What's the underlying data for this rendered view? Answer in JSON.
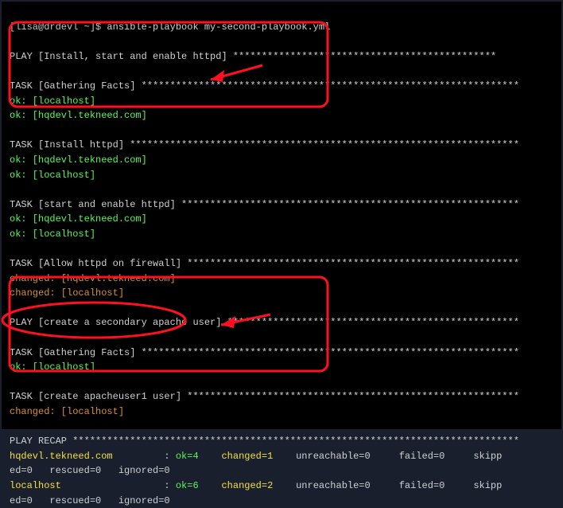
{
  "prompt": {
    "user_host": "[lisa@drdevl ~]$ ",
    "command": "ansible-playbook my-second-playbook.yml"
  },
  "play1": {
    "header": "PLAY [Install, start and enable httpd] **********************************************",
    "task_gather": "TASK [Gathering Facts] ******************************************************************",
    "gather_ok1": "ok: [localhost]",
    "gather_ok2": "ok: [hqdevl.tekneed.com]",
    "task_install": "TASK [Install httpd] ********************************************************************",
    "install_ok1": "ok: [hqdevl.tekneed.com]",
    "install_ok2": "ok: [localhost]",
    "task_start": "TASK [start and enable httpd] ***********************************************************",
    "start_ok1": "ok: [hqdevl.tekneed.com]",
    "start_ok2": "ok: [localhost]",
    "task_firewall": "TASK [Allow httpd on firewall] **********************************************************",
    "fw_chg1": "changed: [hqdevl.tekneed.com]",
    "fw_chg2": "changed: [localhost]"
  },
  "play2": {
    "header": "PLAY [create a secondary apache user] ***************************************************",
    "task_gather": "TASK [Gathering Facts] ******************************************************************",
    "gather_ok1": "ok: [localhost]",
    "task_user": "TASK [create apacheuser1 user] **********************************************************",
    "user_chg1": "changed: [localhost]"
  },
  "recap": {
    "header": "PLAY RECAP ******************************************************************************",
    "host1": "hqdevl.tekneed.com",
    "sep": "         : ",
    "ok1": "ok=4",
    "chg1": "    changed=1",
    "rest1": "    unreachable=0     failed=0     skipp",
    "line1b": "ed=0   rescued=0   ignored=0",
    "host2": "localhost",
    "sep2": "                  : ",
    "ok2": "ok=6",
    "chg2": "    changed=2",
    "rest2": "    unreachable=0     failed=0     skipp",
    "line2b": "ed=0   rescued=0   ignored=0"
  }
}
